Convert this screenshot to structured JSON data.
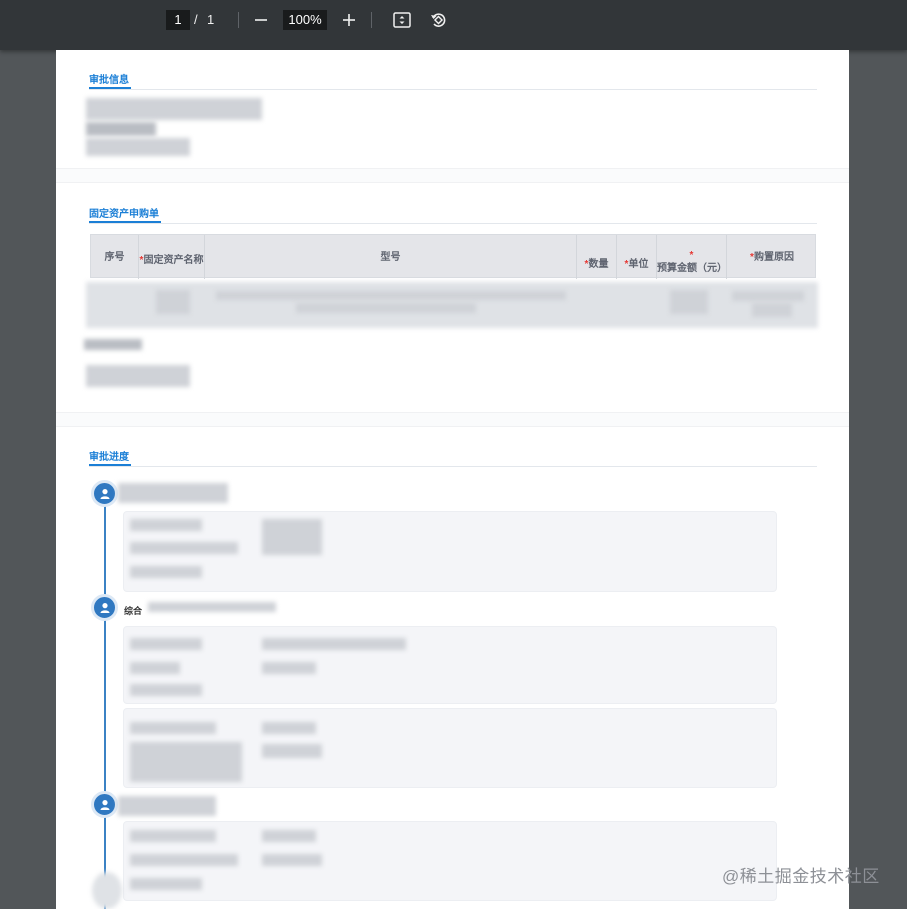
{
  "toolbar": {
    "page_current": "1",
    "page_separator": "/",
    "page_total": "1",
    "zoom_level": "100%",
    "icons": [
      "zoom-out-icon",
      "zoom-in-icon",
      "fit-page-icon",
      "rotate-icon"
    ]
  },
  "sections": {
    "approval_info": {
      "title": "审批信息"
    },
    "asset_form": {
      "title": "固定资产申购单",
      "columns": [
        {
          "label": "序号",
          "required": false
        },
        {
          "label": "固定资产名称",
          "required": true
        },
        {
          "label": "型号",
          "required": false
        },
        {
          "label": "数量",
          "required": true
        },
        {
          "label": "单位",
          "required": true
        },
        {
          "label": "预算金额（元）",
          "required": true
        },
        {
          "label": "购置原因",
          "required": true
        }
      ],
      "required_mark": "*"
    },
    "approval_progress": {
      "title": "审批进度",
      "step2_label": "综合"
    }
  },
  "watermark": "@稀土掘金技术社区",
  "colors": {
    "accent": "#1b7fd6",
    "timeline": "#2f78c1",
    "required": "#e53935",
    "toolbar_bg": "#323639",
    "viewer_bg": "#525659"
  }
}
